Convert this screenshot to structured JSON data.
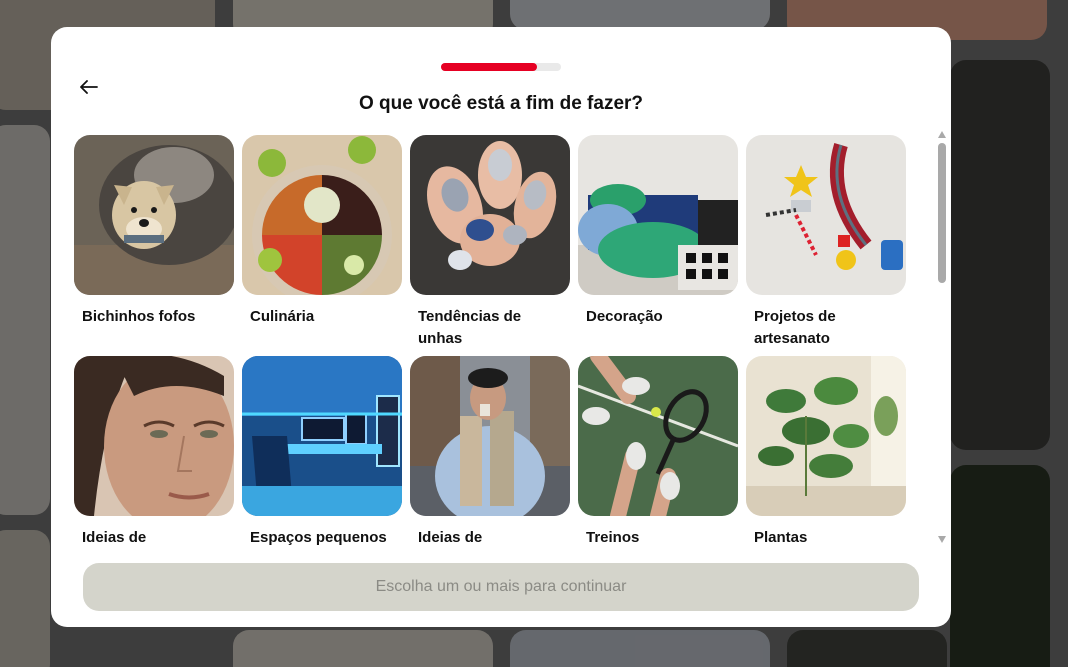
{
  "modal": {
    "title": "O que você está a fim de fazer?",
    "progress": 0.8,
    "continue_label": "Escolha um ou mais para continuar"
  },
  "topics": [
    {
      "label": "Bichinhos fofos",
      "image": "dog-and-raccoon-photo"
    },
    {
      "label": "Culinária",
      "image": "food-bowl-photo"
    },
    {
      "label": "Tendências de unhas",
      "image": "nail-art-photo"
    },
    {
      "label": "Decoração",
      "image": "bedroom-photo"
    },
    {
      "label": "Projetos de artesanato",
      "image": "keychain-crafts-photo"
    },
    {
      "label": "Ideias de",
      "image": "portrait-photo"
    },
    {
      "label": "Espaços pequenos",
      "image": "gaming-room-photo"
    },
    {
      "label": "Ideias de",
      "image": "street-fashion-photo"
    },
    {
      "label": "Treinos",
      "image": "tennis-photo"
    },
    {
      "label": "Plantas",
      "image": "houseplants-photo"
    }
  ],
  "colors": {
    "accent": "#e60023",
    "track": "#e9e9e9",
    "button_disabled_bg": "#d4d4cb",
    "button_disabled_text": "#8b8b85"
  }
}
